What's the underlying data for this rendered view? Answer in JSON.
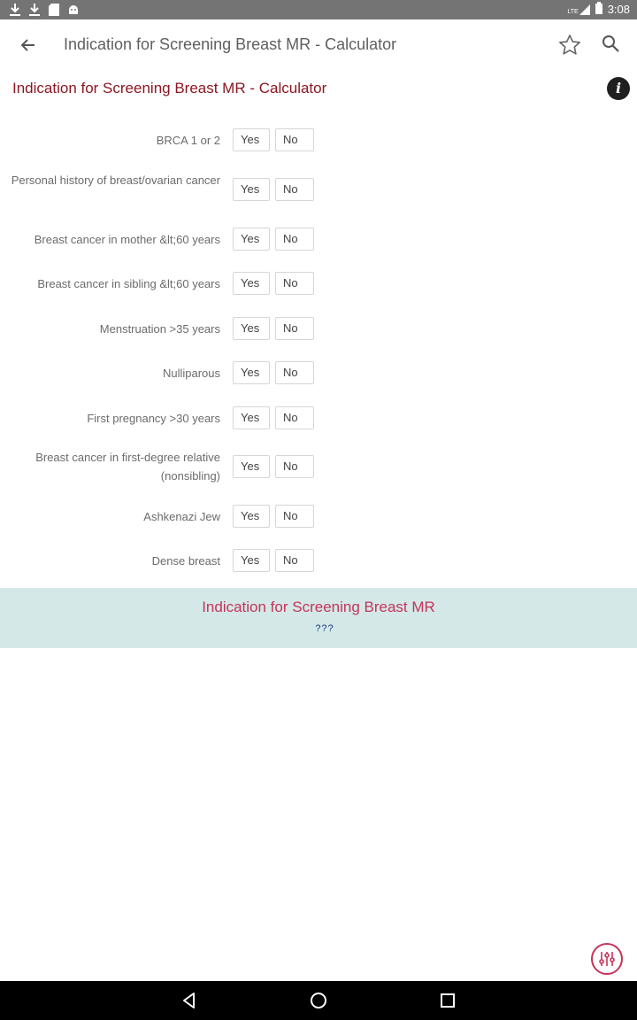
{
  "status_bar": {
    "icons": [
      "download-icon",
      "download-icon",
      "sd-card-icon",
      "android-icon"
    ],
    "network": "LTE",
    "battery_icon": "battery-icon",
    "time": "3:08"
  },
  "app_bar": {
    "title": "Indication for Screening Breast MR - Calculator"
  },
  "page": {
    "title": "Indication for Screening Breast MR - Calculator",
    "info_glyph": "i"
  },
  "questions": [
    {
      "label": "BRCA 1 or 2",
      "yes": "Yes",
      "no": "No"
    },
    {
      "label": "Personal history of breast/ovarian cancer",
      "yes": "Yes",
      "no": "No"
    },
    {
      "label": "Breast cancer in mother &lt;60 years",
      "yes": "Yes",
      "no": "No"
    },
    {
      "label": "Breast cancer in sibling &lt;60 years",
      "yes": "Yes",
      "no": "No"
    },
    {
      "label": "Menstruation >35 years",
      "yes": "Yes",
      "no": "No"
    },
    {
      "label": "Nulliparous",
      "yes": "Yes",
      "no": "No"
    },
    {
      "label": "First pregnancy >30 years",
      "yes": "Yes",
      "no": "No"
    },
    {
      "label": "Breast cancer in first-degree relative (nonsibling)",
      "yes": "Yes",
      "no": "No"
    },
    {
      "label": "Ashkenazi Jew",
      "yes": "Yes",
      "no": "No"
    },
    {
      "label": "Dense breast",
      "yes": "Yes",
      "no": "No"
    }
  ],
  "result": {
    "title": "Indication for Screening Breast MR",
    "value": "???"
  },
  "colors": {
    "accent": "#8c1722",
    "result_title": "#c2345a",
    "result_bg": "#d5e8e8",
    "status_bar": "#747474"
  }
}
